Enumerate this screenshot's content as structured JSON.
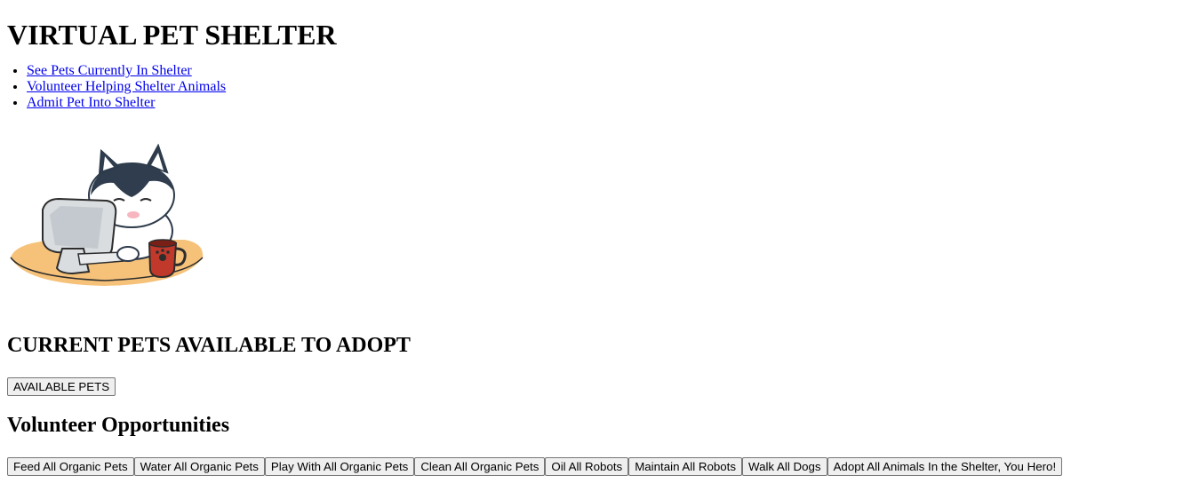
{
  "header": {
    "title": "VIRTUAL PET SHELTER"
  },
  "nav": {
    "links": [
      {
        "label": "See Pets Currently In Shelter"
      },
      {
        "label": "Volunteer Helping Shelter Animals"
      },
      {
        "label": "Admit Pet Into Shelter"
      }
    ]
  },
  "hero": {
    "image": "husky-at-computer-illustration"
  },
  "adopt_section": {
    "heading": "CURRENT PETS AVAILABLE TO ADOPT",
    "button_label": "AVAILABLE PETS"
  },
  "volunteer_section": {
    "heading": "Volunteer Opportunities",
    "buttons": [
      {
        "label": "Feed All Organic Pets"
      },
      {
        "label": "Water All Organic Pets"
      },
      {
        "label": "Play With All Organic Pets"
      },
      {
        "label": "Clean All Organic Pets"
      },
      {
        "label": "Oil All Robots"
      },
      {
        "label": "Maintain All Robots"
      },
      {
        "label": "Walk All Dogs"
      },
      {
        "label": "Adopt All Animals In the Shelter, You Hero!"
      }
    ]
  },
  "colors": {
    "link": "#0000ee",
    "button_bg": "#efefef",
    "button_border": "#767676"
  }
}
